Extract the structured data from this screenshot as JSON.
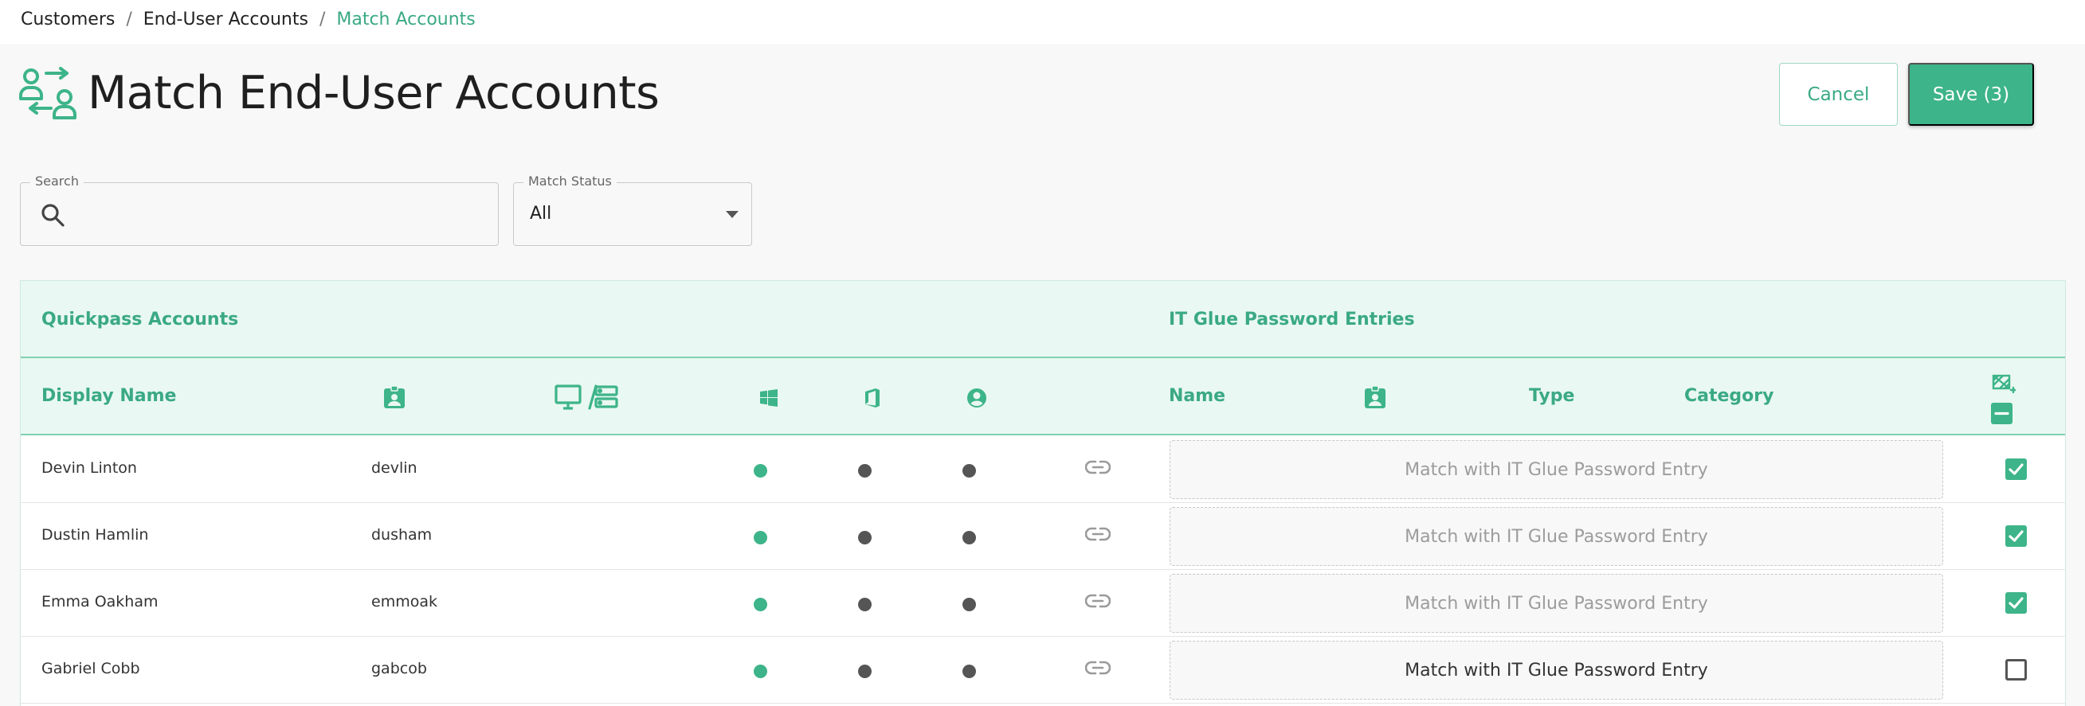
{
  "breadcrumb": {
    "items": [
      "Customers",
      "End-User Accounts"
    ],
    "current": "Match Accounts",
    "separator": "/"
  },
  "page": {
    "title": "Match End-User Accounts",
    "icon": "users-swap-icon"
  },
  "actions": {
    "cancel_label": "Cancel",
    "save_label": "Save (3)"
  },
  "filters": {
    "search_label": "Search",
    "search_value": "",
    "search_placeholder": "",
    "status_label": "Match Status",
    "status_value": "All"
  },
  "table": {
    "group_left": "Quickpass Accounts",
    "group_right": "IT Glue Password Entries",
    "columns": {
      "display_name": "Display Name",
      "username_icon": "contact-badge-icon",
      "devices_icon": "desktop-server-icon",
      "windows_icon": "windows-icon",
      "office_icon": "office-icon",
      "user_icon": "user-circle-icon",
      "name": "Name",
      "right_username_icon": "contact-badge-icon",
      "type": "Type",
      "category": "Category",
      "select_icons": [
        "grid-add-icon",
        "deselect-minus-icon"
      ]
    },
    "match_placeholder": "Match with IT Glue Password Entry",
    "rows": [
      {
        "display_name": "Devin Linton",
        "username": "devlin",
        "windows": "active",
        "office": "inactive",
        "user": "inactive",
        "match_enabled": false,
        "checked": true
      },
      {
        "display_name": "Dustin Hamlin",
        "username": "dusham",
        "windows": "active",
        "office": "inactive",
        "user": "inactive",
        "match_enabled": false,
        "checked": true
      },
      {
        "display_name": "Emma Oakham",
        "username": "emmoak",
        "windows": "active",
        "office": "inactive",
        "user": "inactive",
        "match_enabled": false,
        "checked": true
      },
      {
        "display_name": "Gabriel Cobb",
        "username": "gabcob",
        "windows": "active",
        "office": "inactive",
        "user": "inactive",
        "match_enabled": true,
        "checked": false
      }
    ]
  },
  "colors": {
    "accent": "#3db489",
    "accent_text": "#3aa985",
    "header_bg": "#e9f8f2",
    "inactive_dot": "#555555"
  }
}
